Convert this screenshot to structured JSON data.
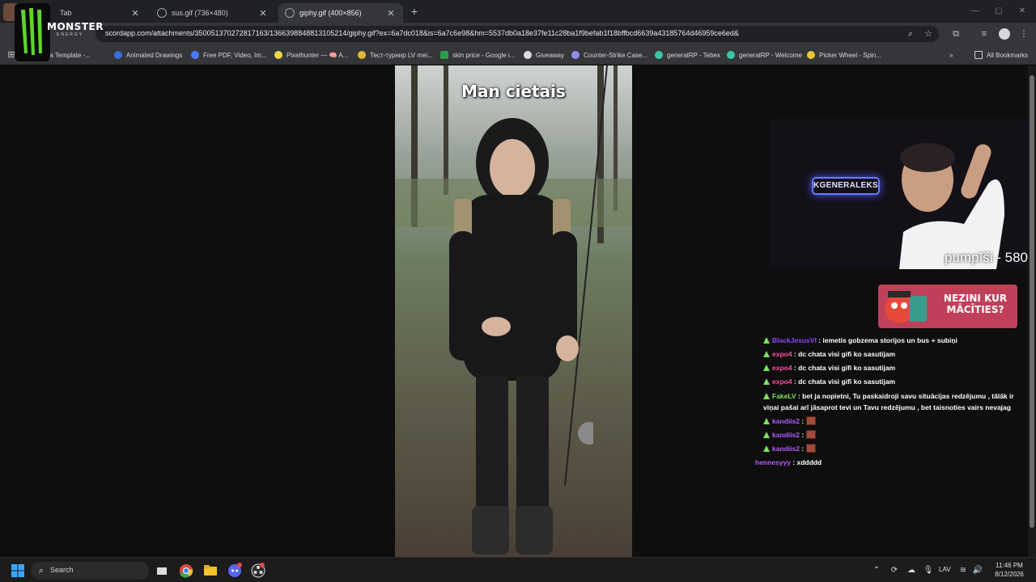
{
  "browser": {
    "tabs": [
      {
        "label": "Tab"
      },
      {
        "label": "sus.gif (736×480)"
      },
      {
        "label": "giphy.gif (400×856)"
      }
    ],
    "url": "scordapp.com/attachments/350051370272817163/1366398848813105214/giphy.gif?ex=6a7dc018&is=6a7c6e98&hm=5537db0a18e37fe11c28ba1f9befab1f18bffbcd6639a43185764d46959ce6ed&",
    "bookmarks": [
      "ate a Template -...",
      "Animated Drawings",
      "Free PDF, Video, Im...",
      "Pixelhunter — 🧠 A...",
      "Тест-турнир LV mei...",
      "skin price - Google i...",
      "Giveaway",
      "Counter-Strike Case...",
      "generalRP - Tebex",
      "generalRP - Welcome",
      "Picker Wheel - Spin..."
    ],
    "bookmarks_more": "»",
    "all_bookmarks": "All Bookmarks"
  },
  "overlay": {
    "logo_text": "MONSTER",
    "logo_sub": "ENERGY",
    "gif_caption": "Man cietais",
    "neon_sign": "KGENERALEKS",
    "counter": "pumpīši - 580",
    "ad_text": "NEZINI KUR MĀCĪTIES?"
  },
  "chat": [
    {
      "user": "BlackJesusVI",
      "color": "#9146ff",
      "text": " : iemetis gobzema storijos un bus + subiņi",
      "badge": "gold"
    },
    {
      "user": "expo4",
      "color": "#ff4ea0",
      "text": " : dc chata visi gifi ko sasutijam",
      "badge": "gold"
    },
    {
      "user": "expo4",
      "color": "#ff4ea0",
      "text": " : dc chata visi gifi ko sasutijam",
      "badge": "gold"
    },
    {
      "user": "expo4",
      "color": "#ff4ea0",
      "text": " : dc chata visi gifi ko sasutijam",
      "badge": "gold"
    },
    {
      "user": "FakeLV",
      "color": "#7be35c",
      "text": " : bet ja nopietni, Tu paskaidroji savu situācijas redzējumu , tālāk ir viņai pašai arī jāsaprot tevi un Tavu redzējumu , bet taisnoties vairs nevajag",
      "badge": "gold"
    },
    {
      "user": "kandiis2",
      "color": "#b25cff",
      "text": " : ",
      "badge": "gold",
      "emote": true
    },
    {
      "user": "kandiis2",
      "color": "#b25cff",
      "text": " : ",
      "badge": "gold",
      "emote": true
    },
    {
      "user": "kandiis2",
      "color": "#b25cff",
      "text": " : ",
      "badge": "gold",
      "emote": true
    },
    {
      "user": "hennesyyy",
      "color": "#b25cff",
      "text": " : xddddd",
      "badge": "none"
    }
  ],
  "taskbar": {
    "search_label": "Search",
    "lang": "LAV",
    "time": "11:46 PM",
    "date": "8/12/2026"
  },
  "colors": {
    "chrome_bg": "#202124",
    "toolbar_bg": "#35363a",
    "page_bg": "#0e0e0e",
    "ad_bg": "#c0405a"
  }
}
